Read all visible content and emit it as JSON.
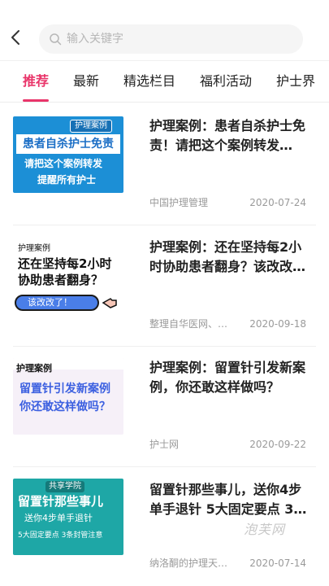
{
  "search": {
    "placeholder": "输入关键字"
  },
  "tabs": [
    {
      "label": "推荐",
      "active": true
    },
    {
      "label": "最新"
    },
    {
      "label": "精选栏目"
    },
    {
      "label": "福利活动"
    },
    {
      "label": "护士界"
    }
  ],
  "colors": {
    "accent": "#e9356a"
  },
  "articles": [
    {
      "title": "护理案例：患者自杀护士免责！请把这个案例转发…",
      "source": "中国护理管理",
      "date": "2020-07-24",
      "thumb": {
        "tag": "护理案例",
        "line1": "患者自杀护士免责",
        "line2": "请把这个案例转发",
        "line3": "提醒所有护士"
      }
    },
    {
      "title": "护理案例：还在坚持每2小时协助患者翻身？该改改…",
      "source": "整理自华医网、…",
      "date": "2020-09-18",
      "thumb": {
        "tag": "护理案例",
        "line1": "还在坚持每2小时",
        "line2": "协助患者翻身？",
        "pill": "该改改了！"
      }
    },
    {
      "title": "护理案例：留置针引发新案例，你还敢这样做吗？",
      "source": "护士网",
      "date": "2020-09-22",
      "thumb": {
        "tag": "护理案例",
        "line1": "留置针引发新案例",
        "line2": "你还敢这样做吗？"
      }
    },
    {
      "title": "留置针那些事儿，送你4步单手退针 5大固定要点 3…",
      "source": "纳洛酮的护理天…",
      "date": "2020-07-14",
      "thumb": {
        "tag": "共享学院",
        "line1": "留置针那些事儿",
        "line2": "送你4步单手退针",
        "line3": "5大固定要点  3条封管注意"
      }
    }
  ],
  "watermark": "泡芙网"
}
